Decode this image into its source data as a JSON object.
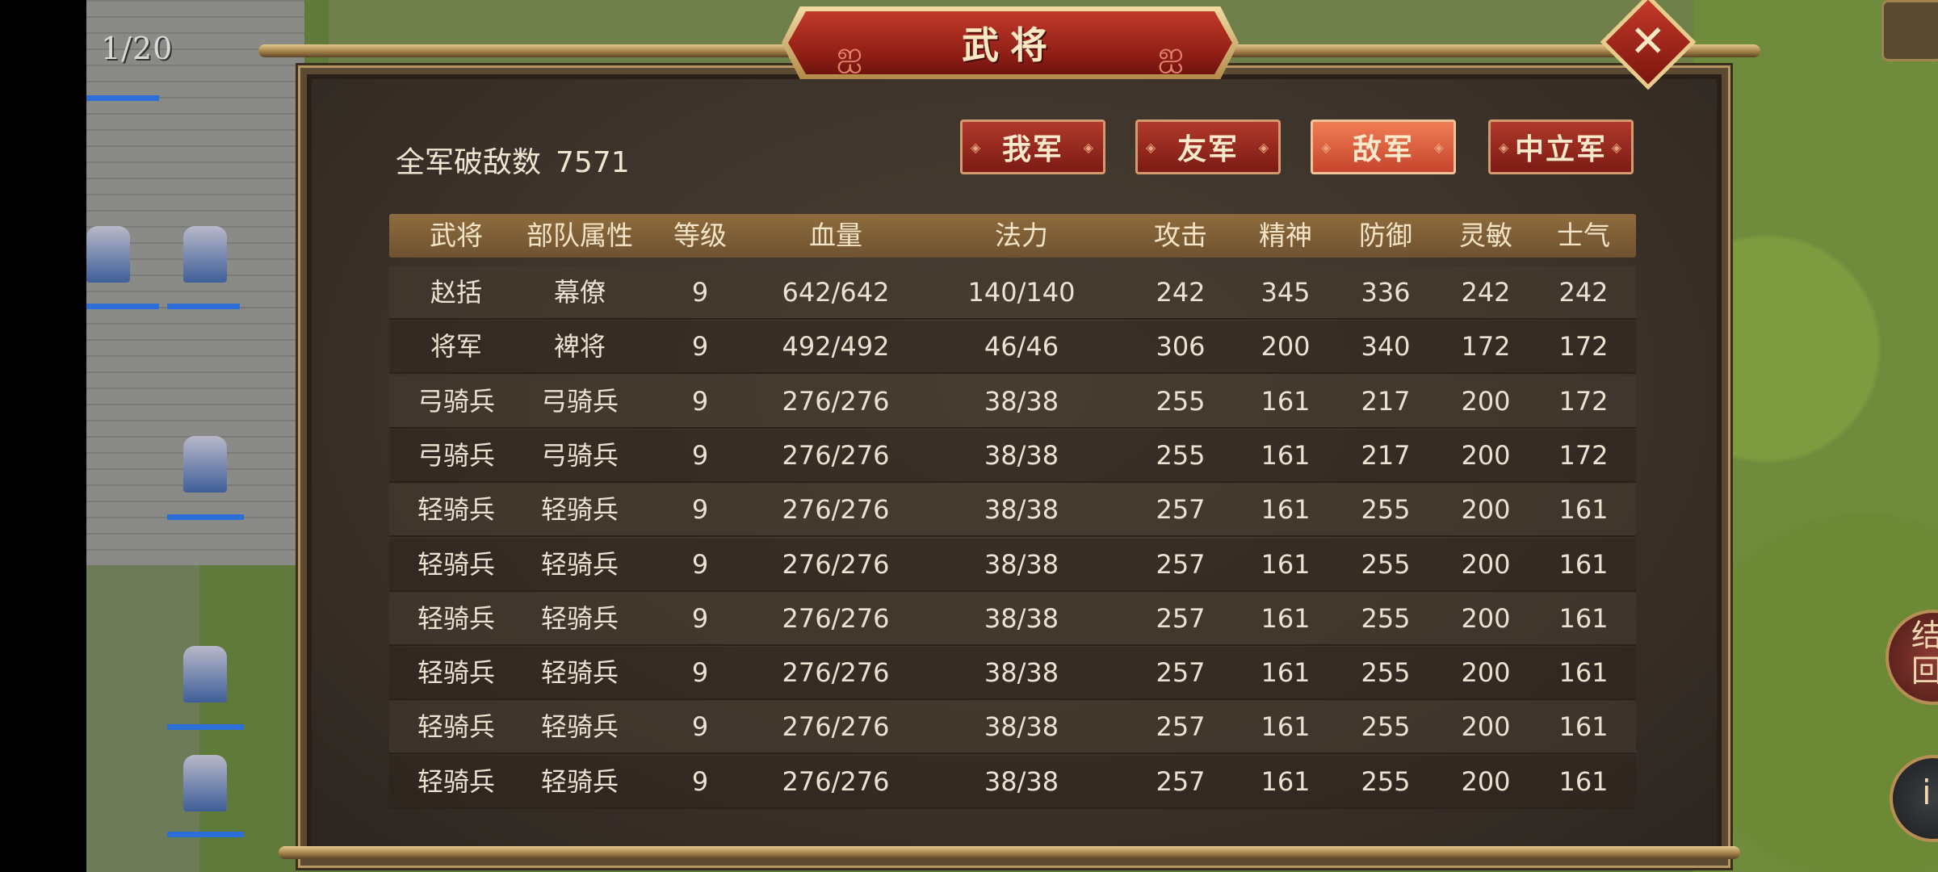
{
  "hud": {
    "level_counter": "1/20",
    "side_button_label": "结回",
    "info_button_label": "i"
  },
  "dialog": {
    "title": "武将",
    "kills_label": "全军破敌数",
    "kills_value": "7571",
    "tabs": [
      {
        "label": "我军",
        "active": false
      },
      {
        "label": "友军",
        "active": false
      },
      {
        "label": "敌军",
        "active": true
      },
      {
        "label": "中立军",
        "active": false
      }
    ],
    "columns": [
      "武将",
      "部队属性",
      "等级",
      "血量",
      "法力",
      "攻击",
      "精神",
      "防御",
      "灵敏",
      "士气"
    ],
    "rows": [
      [
        "赵括",
        "幕僚",
        "9",
        "642/642",
        "140/140",
        "242",
        "345",
        "336",
        "242",
        "242"
      ],
      [
        "将军",
        "裨将",
        "9",
        "492/492",
        "46/46",
        "306",
        "200",
        "340",
        "172",
        "172"
      ],
      [
        "弓骑兵",
        "弓骑兵",
        "9",
        "276/276",
        "38/38",
        "255",
        "161",
        "217",
        "200",
        "172"
      ],
      [
        "弓骑兵",
        "弓骑兵",
        "9",
        "276/276",
        "38/38",
        "255",
        "161",
        "217",
        "200",
        "172"
      ],
      [
        "轻骑兵",
        "轻骑兵",
        "9",
        "276/276",
        "38/38",
        "257",
        "161",
        "255",
        "200",
        "161"
      ],
      [
        "轻骑兵",
        "轻骑兵",
        "9",
        "276/276",
        "38/38",
        "257",
        "161",
        "255",
        "200",
        "161"
      ],
      [
        "轻骑兵",
        "轻骑兵",
        "9",
        "276/276",
        "38/38",
        "257",
        "161",
        "255",
        "200",
        "161"
      ],
      [
        "轻骑兵",
        "轻骑兵",
        "9",
        "276/276",
        "38/38",
        "257",
        "161",
        "255",
        "200",
        "161"
      ],
      [
        "轻骑兵",
        "轻骑兵",
        "9",
        "276/276",
        "38/38",
        "257",
        "161",
        "255",
        "200",
        "161"
      ],
      [
        "轻骑兵",
        "轻骑兵",
        "9",
        "276/276",
        "38/38",
        "257",
        "161",
        "255",
        "200",
        "161"
      ]
    ]
  },
  "colors": {
    "accent_red": "#b0392b",
    "active_tab": "#f07d55",
    "gold_frame": "#e4c98c",
    "panel_bg": "#3b322a"
  }
}
